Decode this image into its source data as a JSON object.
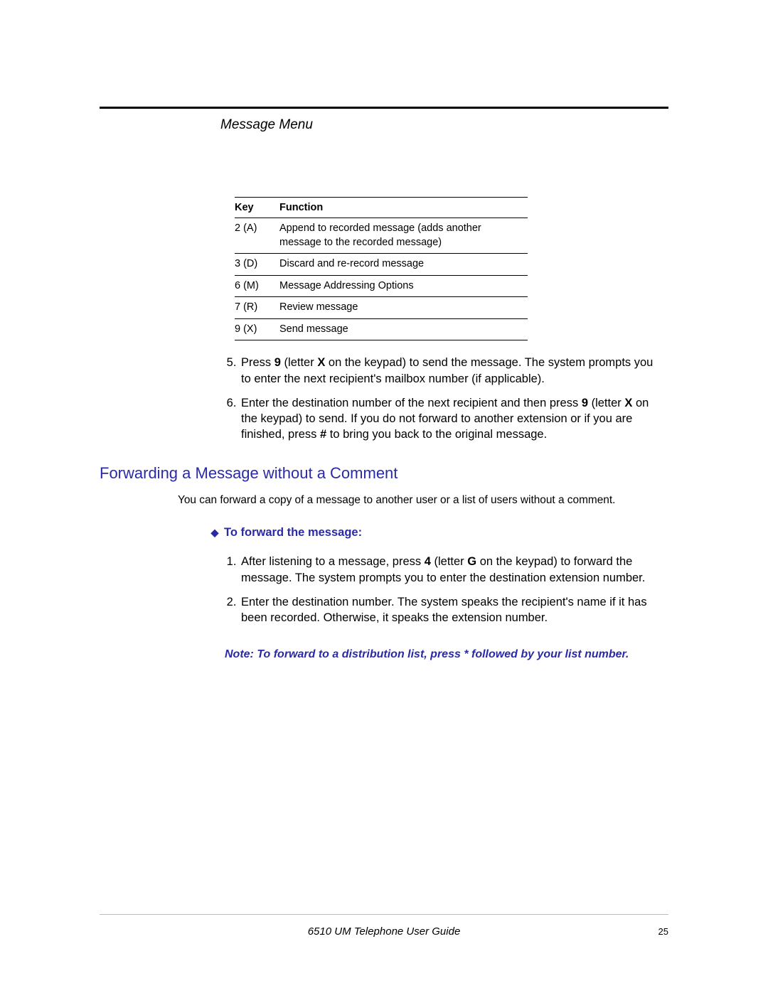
{
  "section_title": "Message Menu",
  "table": {
    "headers": {
      "key": "Key",
      "function": "Function"
    },
    "rows": [
      {
        "key": "2 (A)",
        "function": "Append to recorded message (adds another message to the recorded message)"
      },
      {
        "key": "3 (D)",
        "function": "Discard and re-record message"
      },
      {
        "key": "6 (M)",
        "function": "Message Addressing Options"
      },
      {
        "key": "7 (R)",
        "function": "Review message"
      },
      {
        "key": "9 (X)",
        "function": "Send message"
      }
    ]
  },
  "steps_upper": [
    {
      "prefix": "Press ",
      "b1": "9",
      "mid1": " (letter ",
      "b2": "X",
      "mid2": " on the keypad) to send the message. The system prompts you to enter the next recipient's mailbox number (if applicable)."
    },
    {
      "prefix": "Enter the destination number of the next recipient and then press ",
      "b1": "9",
      "mid1": " (letter ",
      "b2": "X",
      "mid2": " on the keypad) to send. If you do not forward to another extension or if you are finished, press ",
      "b3": "#",
      "mid3": " to bring you back to the original message."
    }
  ],
  "h2": "Forwarding a Message without a Comment",
  "lead": "You can forward a copy of a message to another user or a list of users without a comment.",
  "subheading": "To forward the message:",
  "diamond": "◆",
  "steps_lower": [
    {
      "prefix": "After listening to a message, press ",
      "b1": "4",
      "mid1": " (letter ",
      "b2": "G",
      "mid2": " on the keypad) to forward the message. The system prompts you to enter the destination extension number."
    },
    {
      "text": "Enter the destination number. The system speaks the recipient's name if it has been recorded. Otherwise, it speaks the extension number."
    }
  ],
  "note": "Note: To forward to a distribution list, press * followed by your list number.",
  "footer": {
    "title": "6510 UM Telephone User Guide",
    "page": "25"
  }
}
